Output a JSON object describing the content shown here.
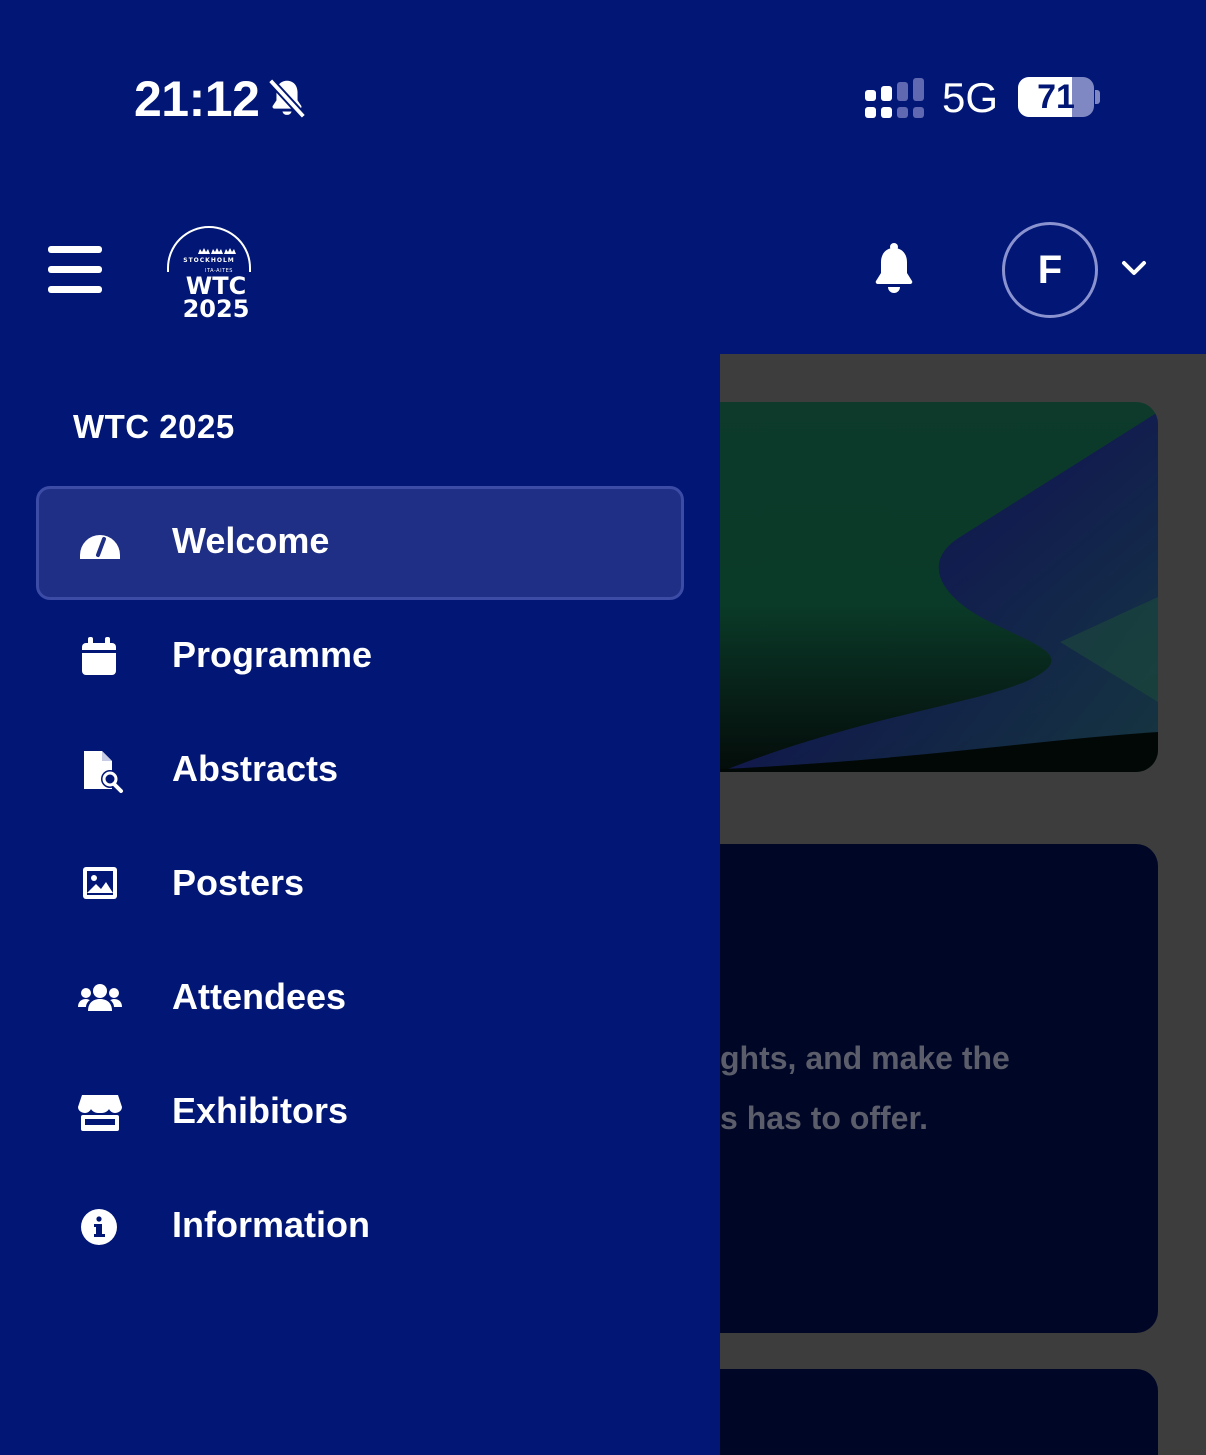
{
  "status_bar": {
    "time": "21:12",
    "network": "5G",
    "battery": "71",
    "battery_level": 0.71
  },
  "header": {
    "logo": {
      "top": "STOCKHOLM",
      "sub": "ITA-AITES",
      "name": "WTC",
      "year": "2025"
    },
    "avatar_initial": "F"
  },
  "drawer": {
    "title": "WTC 2025",
    "items": [
      {
        "label": "Welcome",
        "icon": "gauge-icon",
        "active": true
      },
      {
        "label": "Programme",
        "icon": "calendar-icon",
        "active": false
      },
      {
        "label": "Abstracts",
        "icon": "file-search-icon",
        "active": false
      },
      {
        "label": "Posters",
        "icon": "image-icon",
        "active": false
      },
      {
        "label": "Attendees",
        "icon": "users-icon",
        "active": false
      },
      {
        "label": "Exhibitors",
        "icon": "store-icon",
        "active": false
      },
      {
        "label": "Information",
        "icon": "info-icon",
        "active": false
      }
    ]
  },
  "background": {
    "card_lines": [
      "ghts, and make the",
      "s has to offer."
    ]
  },
  "colors": {
    "primary": "#011675",
    "active_item": "#1f2f85",
    "overlay": "#3d3d3d"
  }
}
